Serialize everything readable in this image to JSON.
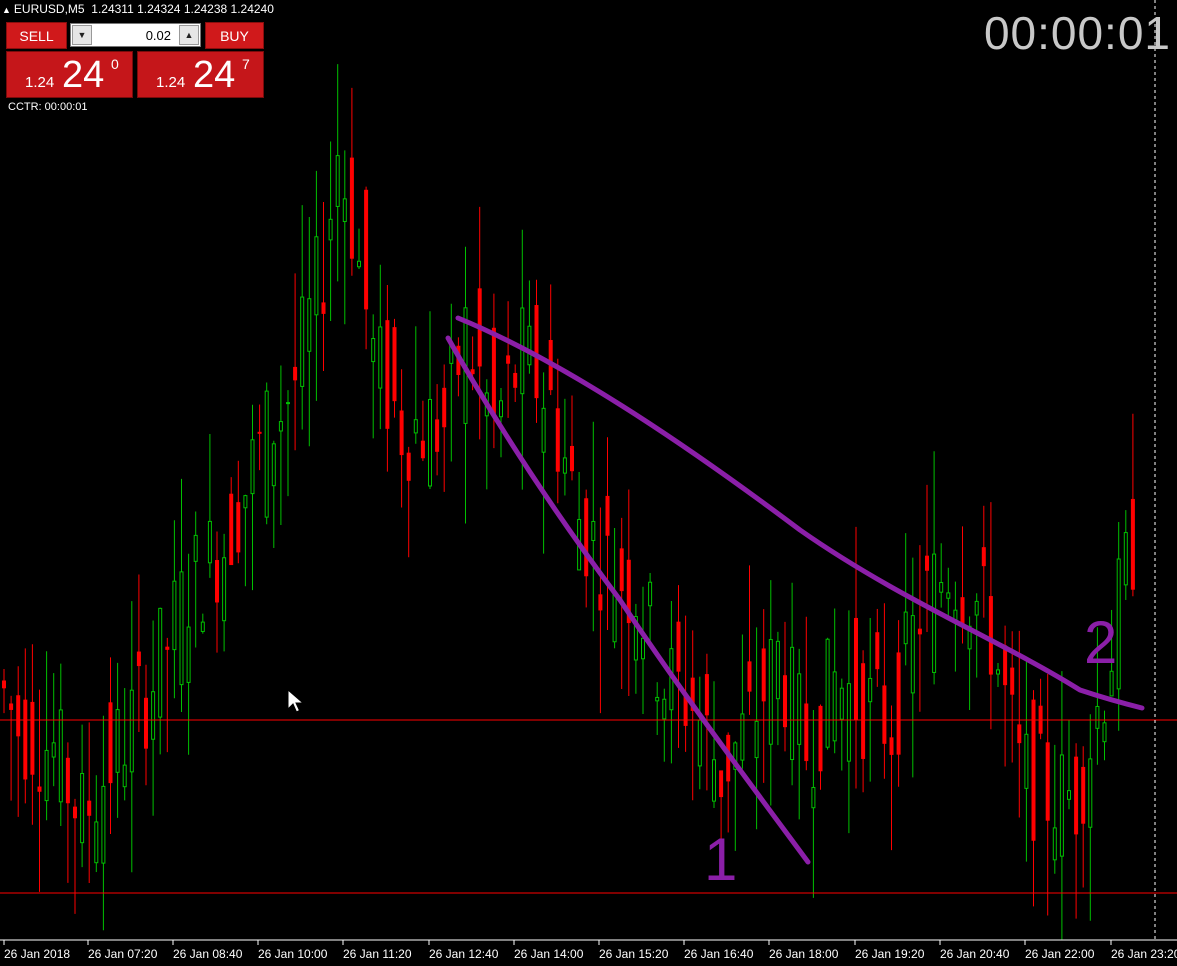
{
  "header": {
    "symbol_label": "EURUSD,M5",
    "ohlc": "1.24311 1.24324 1.24238 1.24240",
    "triangle_icon": "up-triangle"
  },
  "timer": "00:00:01",
  "cctr": "CCTR: 00:00:01",
  "trade_panel": {
    "sell_label": "SELL",
    "buy_label": "BUY",
    "lot_value": "0.02",
    "sell_price": {
      "prefix": "1.24",
      "big": "24",
      "sup": "0"
    },
    "buy_price": {
      "prefix": "1.24",
      "big": "24",
      "sup": "7"
    }
  },
  "colors": {
    "background": "#000000",
    "bull": "#00c000",
    "bear": "#ff0000",
    "level_line": "#ff0000",
    "annotation": "#8b1fa8",
    "axis_text": "#ffffff"
  },
  "annotations": {
    "label_1": "1",
    "label_2": "2"
  },
  "x_axis_labels": [
    "26 Jan 2018",
    "26 Jan 07:20",
    "26 Jan 08:40",
    "26 Jan 10:00",
    "26 Jan 11:20",
    "26 Jan 12:40",
    "26 Jan 14:00",
    "26 Jan 15:20",
    "26 Jan 16:40",
    "26 Jan 18:00",
    "26 Jan 19:20",
    "26 Jan 20:40",
    "26 Jan 22:00",
    "26 Jan 23:20"
  ],
  "chart_data": {
    "type": "candlestick",
    "symbol": "EURUSD",
    "timeframe": "M5",
    "bid": "1.24240",
    "ask": "1.24247",
    "waypoints": [
      [
        0,
        1.2414
      ],
      [
        3,
        1.2412
      ],
      [
        8,
        1.2411
      ],
      [
        12,
        1.2408
      ],
      [
        17,
        1.2411
      ],
      [
        22,
        1.2414
      ],
      [
        27,
        1.2418
      ],
      [
        32,
        1.242
      ],
      [
        37,
        1.2424
      ],
      [
        42,
        1.2427
      ],
      [
        46,
        1.2432
      ],
      [
        48,
        1.2437
      ],
      [
        50,
        1.2434
      ],
      [
        53,
        1.2428
      ],
      [
        57,
        1.2425
      ],
      [
        61,
        1.2425
      ],
      [
        63,
        1.2425
      ],
      [
        66,
        1.2429
      ],
      [
        70,
        1.2425
      ],
      [
        74,
        1.2428
      ],
      [
        78,
        1.2426
      ],
      [
        82,
        1.2421
      ],
      [
        86,
        1.2419
      ],
      [
        90,
        1.2418
      ],
      [
        94,
        1.2414
      ],
      [
        98,
        1.2413
      ],
      [
        102,
        1.241
      ],
      [
        106,
        1.2412
      ],
      [
        110,
        1.2415
      ],
      [
        114,
        1.2411
      ],
      [
        118,
        1.2414
      ],
      [
        122,
        1.2413
      ],
      [
        126,
        1.2412
      ],
      [
        130,
        1.2417
      ],
      [
        134,
        1.2419
      ],
      [
        137,
        1.2418
      ],
      [
        140,
        1.2416
      ],
      [
        144,
        1.241
      ],
      [
        148,
        1.2409
      ],
      [
        152,
        1.2409
      ],
      [
        156,
        1.2414
      ],
      [
        160,
        1.242
      ]
    ],
    "horizontal_levels": [
      1.2415,
      1.2406
    ]
  }
}
